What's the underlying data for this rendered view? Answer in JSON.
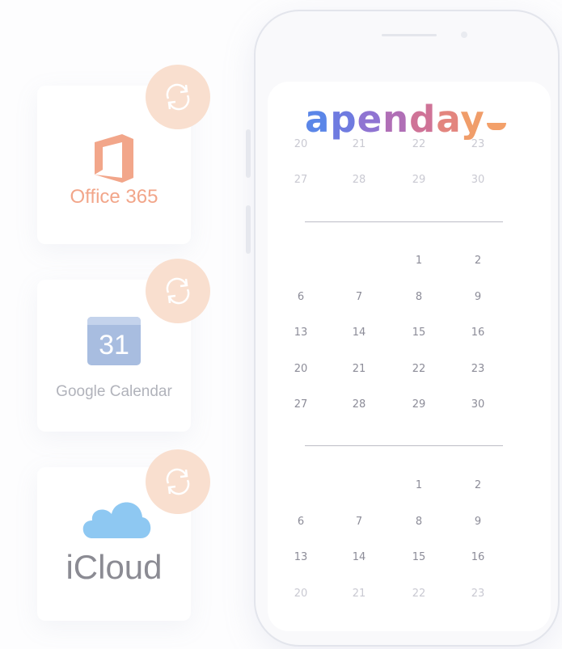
{
  "integrations": [
    {
      "name": "Office 365",
      "icon": "office-365-icon",
      "color": "#f2a68a"
    },
    {
      "name": "Google Calendar",
      "date_number": "31",
      "icon": "google-calendar-icon",
      "color": "#a8bde0"
    },
    {
      "name": "iCloud",
      "icon": "icloud-icon",
      "color": "#8ec8f2"
    }
  ],
  "sync_icon": "sync-arrows-icon",
  "app": {
    "logo_letters": [
      "a",
      "p",
      "e",
      "n",
      "d",
      "a",
      "y"
    ],
    "logo_colors": [
      "#5b86e8",
      "#6f7be0",
      "#8f74d2",
      "#b06fb6",
      "#cf7397",
      "#e3857e",
      "#f09d6a"
    ],
    "accent": "#f3a06a"
  },
  "calendar": {
    "partial_month": [
      [
        "20",
        "21",
        "22",
        "23"
      ],
      [
        "27",
        "28",
        "29",
        "30"
      ]
    ],
    "month": [
      [
        "",
        "",
        "1",
        "2"
      ],
      [
        "6",
        "7",
        "8",
        "9"
      ],
      [
        "13",
        "14",
        "15",
        "16"
      ],
      [
        "20",
        "21",
        "22",
        "23"
      ],
      [
        "27",
        "28",
        "29",
        "30"
      ]
    ],
    "month_bottom": [
      [
        "",
        "",
        "1",
        "2"
      ],
      [
        "6",
        "7",
        "8",
        "9"
      ],
      [
        "13",
        "14",
        "15",
        "16"
      ],
      [
        "20",
        "21",
        "22",
        "23"
      ]
    ]
  }
}
